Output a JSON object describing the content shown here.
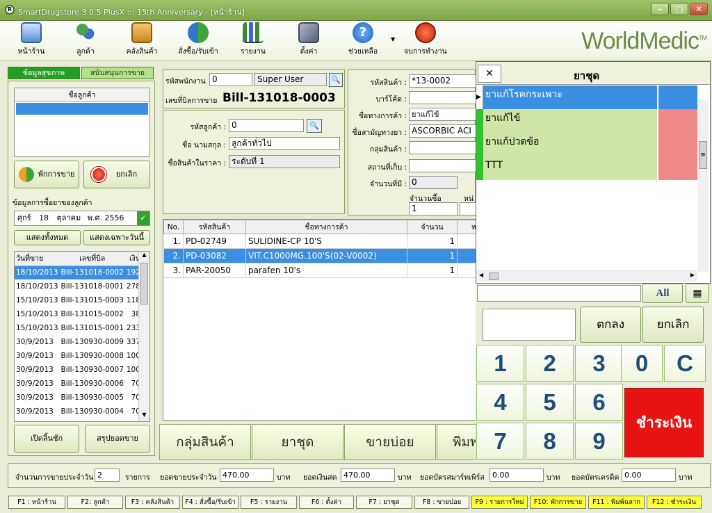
{
  "window": {
    "title": "SmartDrugstore 3.0.5 PlusX ::: 15th Anniversary - [หน้าร้าน]"
  },
  "toolbar": {
    "items": [
      {
        "label": "หน้าร้าน",
        "icon": "monitor-icon"
      },
      {
        "label": "ลูกค้า",
        "icon": "users-icon"
      },
      {
        "label": "คลังสินค้า",
        "icon": "warehouse-icon"
      },
      {
        "label": "สั่งซื้อ/รับเข้า",
        "icon": "exchange-icon"
      },
      {
        "label": "รายงาน",
        "icon": "chart-icon"
      },
      {
        "label": "ตั้งค่า",
        "icon": "tools-icon"
      },
      {
        "label": "ช่วยเหลือ",
        "icon": "help-icon"
      },
      {
        "label": "จบการทำงาน",
        "icon": "power-icon"
      }
    ],
    "logo": "WorldMedic",
    "logo_tm": "TM"
  },
  "left": {
    "tab_active": "ข้อมูลสุขภาพ",
    "tab_other": "สนับสนุนการขาย",
    "customer_header": "ชื่อลูกค้า",
    "hold_label": "พักการขาย",
    "cancel_label": "ยกเลิก",
    "history_title": "ข้อมูลการซื้อยาของลูกค้า",
    "date": {
      "day": "ศุกร์",
      "num": "18",
      "month": "ตุลาคม",
      "year": "พ.ศ. 2556"
    },
    "show_all": "แสดงทั้งหมด",
    "show_today": "แสดงเฉพาะวันนี้",
    "history_cols": [
      "วันที่ขาย",
      "เลขที่บิล",
      "เงิน"
    ],
    "history_rows": [
      [
        "18/10/2013",
        "Bill-131018-0002",
        "192"
      ],
      [
        "18/10/2013",
        "Bill-131018-0001",
        "278"
      ],
      [
        "15/10/2013",
        "Bill-131015-0003",
        "118"
      ],
      [
        "15/10/2013",
        "Bill-131015-0002",
        "38"
      ],
      [
        "15/10/2013",
        "Bill-131015-0001",
        "233"
      ],
      [
        "30/9/2013",
        "Bill-130930-0009",
        "337"
      ],
      [
        "30/9/2013",
        "Bill-130930-0008",
        "100"
      ],
      [
        "30/9/2013",
        "Bill-130930-0007",
        "100"
      ],
      [
        "30/9/2013",
        "Bill-130930-0006",
        "70"
      ],
      [
        "30/9/2013",
        "Bill-130930-0005",
        "70"
      ],
      [
        "30/9/2013",
        "Bill-130930-0004",
        "70"
      ]
    ],
    "open_drawer": "เปิดลิ้นชัก",
    "summary": "สรุปยอดขาย"
  },
  "bill": {
    "emp_code_label": "รหัสพนักงาน",
    "emp_code": "0",
    "emp_name": "Super User",
    "bill_no_label": "เลขที่บิลการขาย",
    "bill_no": "Bill-131018-0003",
    "cust_code_label": "รหัสลูกค้า :",
    "cust_code": "0",
    "cust_name_label": "ชื่อ นามสกุล :",
    "cust_name": "ลูกค้าทั่วไป",
    "price_label": "ชื่อสินค้าในราคา :",
    "price_level": "ระดับที่ 1"
  },
  "product": {
    "code_label": "รหัสสินค้า :",
    "code": "*13-0002",
    "barcode_label": "บาร์โค้ด :",
    "trade_label": "ชื่อทางการค้า :",
    "trade": "ยาแก้ไข้",
    "generic_label": "ชื่อสามัญทางยา :",
    "generic": "ASCORBIC ACI",
    "group_label": "กลุ่มสินค้า :",
    "location_label": "สถานที่เก็บ :",
    "stock_label": "จำนวนที่มี :",
    "stock": "0",
    "qty_label": "จำนวนซื้อ",
    "qty": "1",
    "unit_label": "หน่"
  },
  "items": {
    "cols": [
      "No.",
      "รหัสสินค้า",
      "ชื่อทางการค้า",
      "จำนวน",
      "ห"
    ],
    "rows": [
      [
        "1.",
        "PD-02749",
        "SULIDINE-CP 10'S",
        "1"
      ],
      [
        "2.",
        "PD-03082",
        "VIT.C1000MG.100'S(02-V0002)",
        "1"
      ],
      [
        "3.",
        "PAR-20050",
        "parafen 10's",
        "1"
      ]
    ]
  },
  "categories": [
    "กลุ่มสินค้า",
    "ยาชุด",
    "ขายบ่อย",
    "พิมพ"
  ],
  "popup": {
    "close": "✕",
    "title": "ยาชุด",
    "sets": [
      "ยาแก้โรคกระเพาะ",
      "ยาแก้ไข้",
      "ยาแก้ปวดข้อ",
      "TTT"
    ],
    "all": "All"
  },
  "keypad": {
    "ok": "ตกลง",
    "cancel": "ยกเลิก",
    "pay": "ชำระเงิน",
    "keys": [
      "1",
      "2",
      "3",
      "0",
      "C",
      "4",
      "5",
      "6",
      "7",
      "8",
      "9"
    ]
  },
  "status": {
    "count_label": "จำนวนการขายประจำวัน",
    "count": "2",
    "count_unit": "รายการ",
    "sales_label": "ยอดขายประจำวัน",
    "sales": "470.00",
    "baht": "บาท",
    "cash_label": "ยอดเงินสด",
    "cash": "470.00",
    "smart_label": "ยอดบัตรสมาร์ทเพิร์ส",
    "smart": "0.00",
    "credit_label": "ยอดบัตรเครดิต",
    "credit": "0.00"
  },
  "fkeys": [
    {
      "label": "F1 : หน้าร้าน",
      "hl": false
    },
    {
      "label": "F2: ลูกค้า",
      "hl": false
    },
    {
      "label": "F3 : คลังสินค้า",
      "hl": false
    },
    {
      "label": "F4 : สั่งซื้อ/รับเข้า",
      "hl": false
    },
    {
      "label": "F5 : รายงาน",
      "hl": false
    },
    {
      "label": "F6 : ตั้งค่า",
      "hl": false
    },
    {
      "label": "F7 : ยาชุด",
      "hl": false
    },
    {
      "label": "F8 : ขายบ่อย",
      "hl": false
    },
    {
      "label": "F9 : รายการใหม่",
      "hl": true
    },
    {
      "label": "F10: พักการขาย",
      "hl": true
    },
    {
      "label": "F11 : พิมพ์ฉลาก",
      "hl": true
    },
    {
      "label": "F12 : ชำระเงิน",
      "hl": true
    }
  ],
  "colors": {
    "accent": "#3a8fe0",
    "brand": "#6d8a48",
    "pay": "#e81414",
    "highlight": "#ffff3b"
  }
}
